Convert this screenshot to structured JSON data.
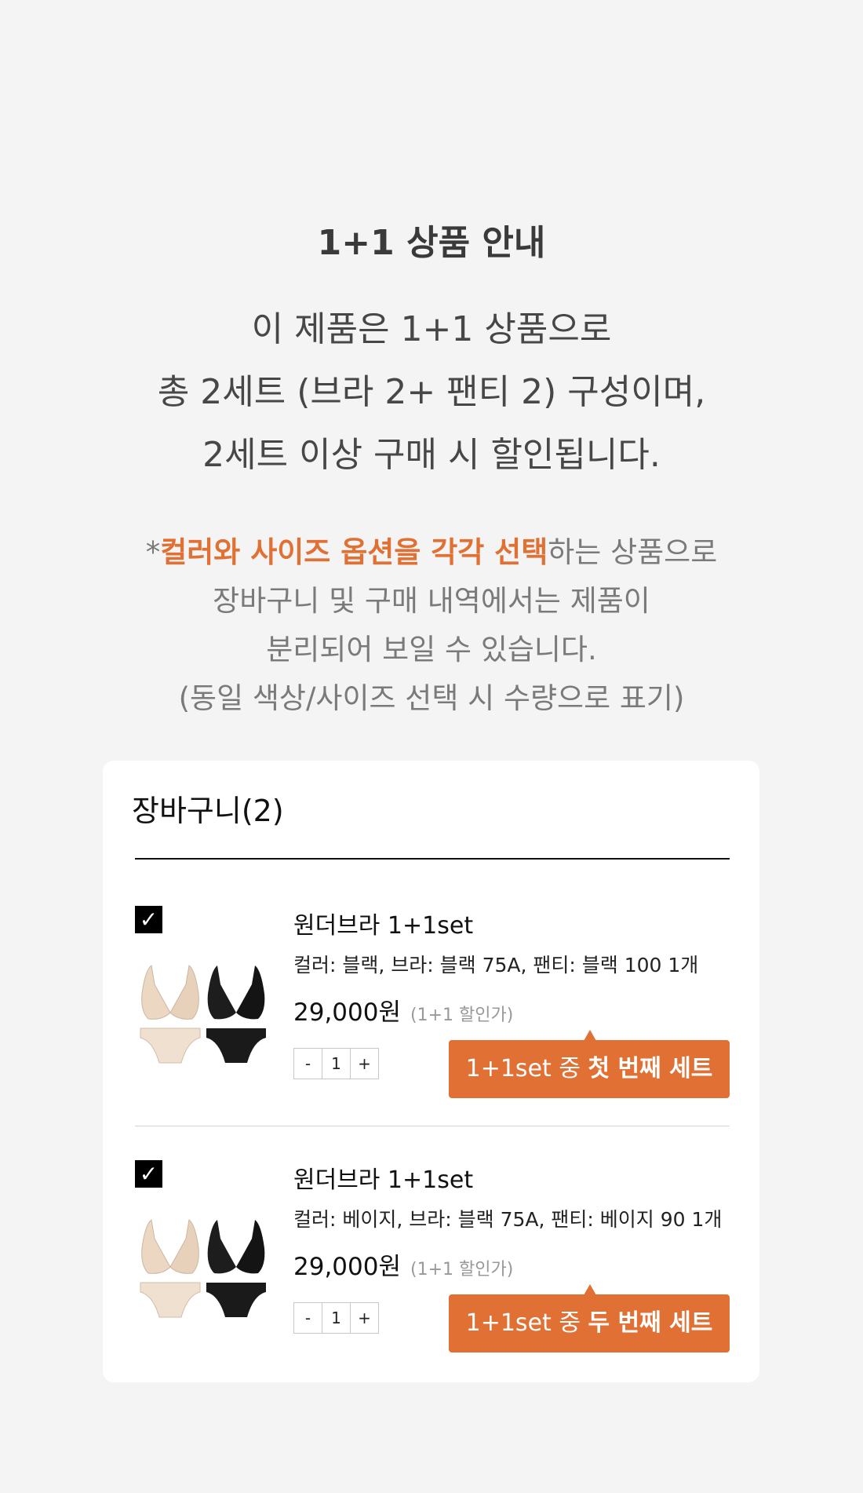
{
  "info": {
    "title": "1+1 상품 안내",
    "desc_lines": [
      "이 제품은 1+1 상품으로",
      "총 2세트 (브라 2+ 팬티 2) 구성이며,",
      "2세트 이상 구매 시 할인됩니다."
    ],
    "note": {
      "prefix": "*",
      "highlight": "컬러와 사이즈 옵션을 각각 선택",
      "line1_rest": "하는 상품으로",
      "line2": "장바구니 및 구매 내역에서는 제품이",
      "line3": "분리되어 보일 수 있습니다.",
      "line4": "(동일 색상/사이즈 선택 시 수량으로 표기)"
    },
    "accent_color": "#e07033"
  },
  "cart": {
    "title": "장바구니(2)",
    "items": [
      {
        "checked": "✓",
        "name": "원더브라 1+1set",
        "option": "컬러: 블랙, 브라: 블랙 75A, 팬티: 블랙 100 1개",
        "price": "29,000원",
        "price_note": "(1+1 할인가)",
        "stepper": {
          "minus": "-",
          "qty": "1",
          "plus": "+"
        },
        "tag_prefix": "1+1set 중 ",
        "tag_strong": "첫 번째 세트",
        "thumb_icon": "bra-set-product-image"
      },
      {
        "checked": "✓",
        "name": "원더브라 1+1set",
        "option": "컬러: 베이지, 브라: 블랙 75A, 팬티: 베이지 90 1개",
        "price": "29,000원",
        "price_note": "(1+1 할인가)",
        "stepper": {
          "minus": "-",
          "qty": "1",
          "plus": "+"
        },
        "tag_prefix": "1+1set 중 ",
        "tag_strong": "두 번째 세트",
        "thumb_icon": "bra-set-product-image"
      }
    ]
  }
}
